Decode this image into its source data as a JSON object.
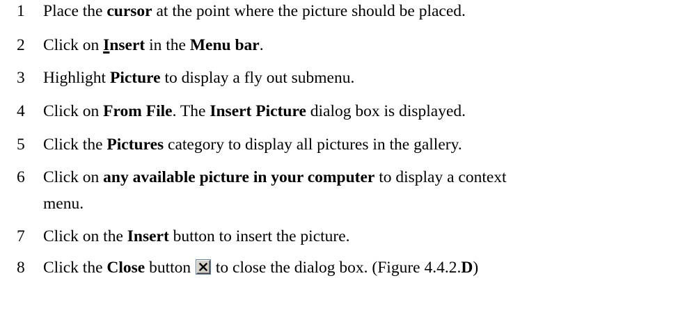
{
  "steps": [
    {
      "number": "1",
      "parts": [
        "Place the ",
        "cursor",
        " at the point where the picture should be placed."
      ]
    },
    {
      "number": "2",
      "parts": [
        "Click on ",
        "I",
        "nsert",
        " in the ",
        "Menu bar",
        "."
      ]
    },
    {
      "number": "3",
      "parts": [
        "Highlight ",
        "Picture",
        " to display a fly out submenu."
      ]
    },
    {
      "number": "4",
      "parts": [
        "Click on ",
        "From File",
        ". The ",
        "Insert Picture",
        " dialog box is displayed."
      ]
    },
    {
      "number": "5",
      "parts": [
        "Click the ",
        "Pictures",
        " category to display all pictures in the gallery."
      ]
    },
    {
      "number": "6",
      "parts": [
        "Click on ",
        "any available picture in your computer",
        " to display a context",
        "menu."
      ]
    },
    {
      "number": "7",
      "parts": [
        "Click on the ",
        "Insert",
        " button to insert the picture."
      ]
    },
    {
      "number": "8",
      "parts": [
        "Click the ",
        "Close",
        " button ",
        " to close the dialog box. (Figure 4.4.2.",
        "D",
        ")"
      ]
    }
  ],
  "icons": {
    "close_button": "close-icon"
  }
}
